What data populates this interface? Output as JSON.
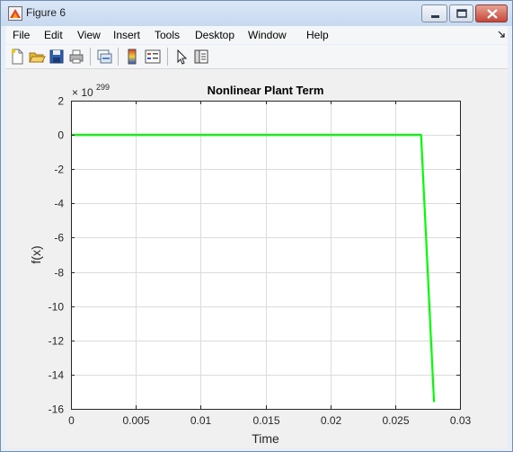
{
  "window": {
    "title": "Figure 6"
  },
  "menu": {
    "items": [
      "File",
      "Edit",
      "View",
      "Insert",
      "Tools",
      "Desktop",
      "Window",
      "Help"
    ]
  },
  "toolbar": {
    "buttons": [
      "new-figure-icon",
      "open-file-icon",
      "save-icon",
      "print-icon",
      "link-plot-icon",
      "colorbar-icon",
      "legend-icon",
      "edit-plot-icon",
      "property-inspector-icon"
    ]
  },
  "chart_data": {
    "type": "line",
    "title": "Nonlinear Plant Term",
    "xlabel": "Time",
    "ylabel": "f(x)",
    "y_multiplier": "× 10",
    "y_exponent": "299",
    "xlim": [
      0,
      0.03
    ],
    "ylim": [
      -16,
      2
    ],
    "x_ticks": [
      0,
      0.005,
      0.01,
      0.015,
      0.02,
      0.025,
      0.03
    ],
    "x_tick_labels": [
      "0",
      "0.005",
      "0.01",
      "0.015",
      "0.02",
      "0.025",
      "0.03"
    ],
    "y_ticks": [
      2,
      0,
      -2,
      -4,
      -6,
      -8,
      -10,
      -12,
      -14,
      -16
    ],
    "y_tick_labels": [
      "2",
      "0",
      "-2",
      "-4",
      "-6",
      "-8",
      "-10",
      "-12",
      "-14",
      "-16"
    ],
    "grid": true,
    "series": [
      {
        "color": "#00ff00",
        "x": [
          0,
          0.0269,
          0.027,
          0.028
        ],
        "y": [
          0,
          0,
          0,
          -15.6
        ]
      }
    ]
  }
}
